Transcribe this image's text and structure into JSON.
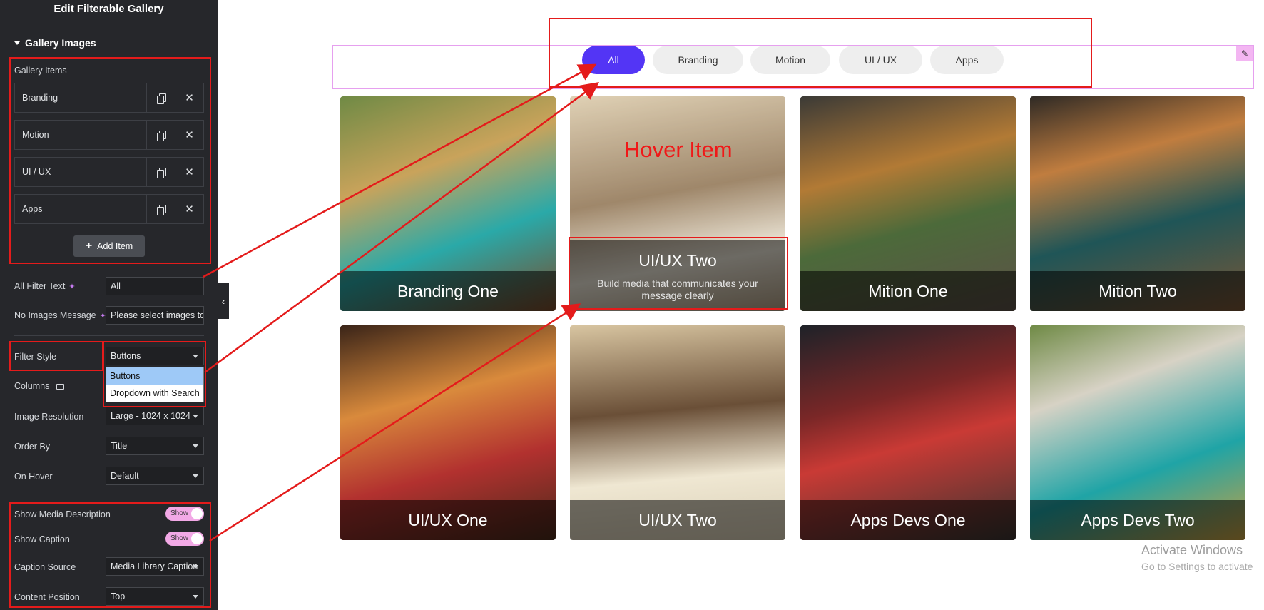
{
  "sidebar": {
    "title": "Edit Filterable Gallery",
    "section_title": "Gallery Images",
    "gallery_items_label": "Gallery Items",
    "items": [
      {
        "title": "Branding"
      },
      {
        "title": "Motion"
      },
      {
        "title": "UI / UX"
      },
      {
        "title": "Apps"
      }
    ],
    "add_item_label": "Add Item",
    "all_filter_text": {
      "label": "All Filter Text",
      "value": "All"
    },
    "no_images_message": {
      "label": "No Images Message",
      "value": "Please select images to"
    },
    "filter_style": {
      "label": "Filter Style",
      "value": "Buttons",
      "options": [
        "Buttons",
        "Dropdown with Search"
      ]
    },
    "columns": {
      "label": "Columns"
    },
    "image_resolution": {
      "label": "Image Resolution",
      "value": "Large - 1024 x 1024"
    },
    "order_by": {
      "label": "Order By",
      "value": "Title"
    },
    "on_hover": {
      "label": "On Hover",
      "value": "Default"
    },
    "show_media_description": {
      "label": "Show Media Description",
      "value": "Show"
    },
    "show_caption": {
      "label": "Show Caption",
      "value": "Show"
    },
    "caption_source": {
      "label": "Caption Source",
      "value": "Media Library Caption"
    },
    "content_position": {
      "label": "Content Position",
      "value": "Top"
    }
  },
  "annotation": {
    "hover_text": "Hover Item"
  },
  "filters": [
    "All",
    "Branding",
    "Motion",
    "UI / UX",
    "Apps"
  ],
  "gallery": [
    {
      "caption": "Branding One"
    },
    {
      "caption": "UI/UX Two",
      "description": "Build media that communicates your message clearly"
    },
    {
      "caption": "Mition One"
    },
    {
      "caption": "Mition Two"
    },
    {
      "caption": "UI/UX One"
    },
    {
      "caption": "UI/UX Two"
    },
    {
      "caption": "Apps Devs One"
    },
    {
      "caption": "Apps Devs Two"
    }
  ],
  "watermark": {
    "line1": "Activate Windows",
    "line2": "Go to Settings to activate"
  },
  "colors": {
    "accent": "#5335f5",
    "annotation": "#e41b1b",
    "sidebar_bg": "#26272b"
  }
}
